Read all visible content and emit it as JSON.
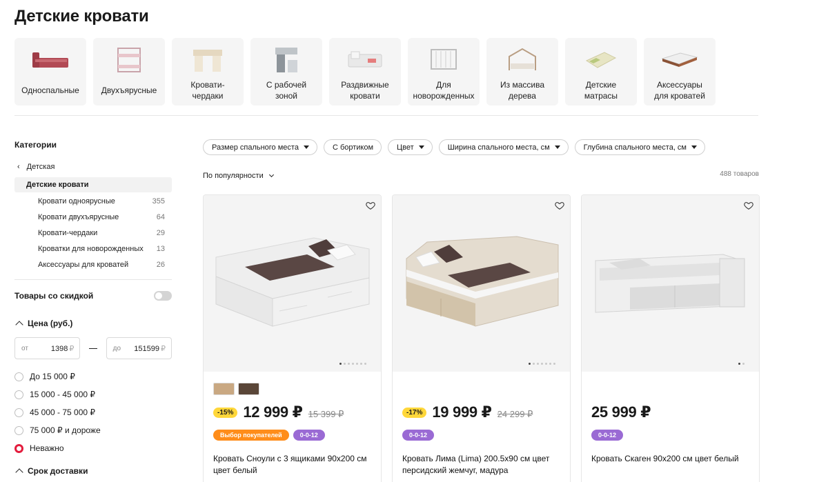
{
  "page": {
    "title": "Детские кровати"
  },
  "categories": [
    {
      "label": "Односпальные",
      "icon": "single-bed-icon"
    },
    {
      "label": "Двухъярусные",
      "icon": "bunk-bed-icon"
    },
    {
      "label": "Кровати-\nчердаки",
      "icon": "loft-bed-icon"
    },
    {
      "label": "С рабочей\nзоной",
      "icon": "workspace-bed-icon"
    },
    {
      "label": "Раздвижные\nкровати",
      "icon": "extendable-bed-icon"
    },
    {
      "label": "Для\nноворожденных",
      "icon": "crib-icon"
    },
    {
      "label": "Из массива\nдерева",
      "icon": "house-bed-icon"
    },
    {
      "label": "Детские\nматрасы",
      "icon": "mattress-icon"
    },
    {
      "label": "Аксессуары\nдля кроватей",
      "icon": "bed-accessory-icon"
    }
  ],
  "sidebar": {
    "heading": "Категории",
    "back_label": "Детская",
    "current": "Детские кровати",
    "subcategories": [
      {
        "label": "Кровати одноярусные",
        "count": "355"
      },
      {
        "label": "Кровати двухъярусные",
        "count": "64"
      },
      {
        "label": "Кровати-чердаки",
        "count": "29"
      },
      {
        "label": "Кроватки для новорожденных",
        "count": "13"
      },
      {
        "label": "Аксессуары для кроватей",
        "count": "26"
      }
    ],
    "discount_label": "Товары со скидкой",
    "discount_on": false,
    "price_heading": "Цена (руб.)",
    "price_from_prefix": "от",
    "price_from": "1398",
    "price_to_prefix": "до",
    "price_to": "151599",
    "currency": "₽",
    "price_options": [
      {
        "label": "До 15 000 ₽",
        "selected": false
      },
      {
        "label": "15 000 - 45 000 ₽",
        "selected": false
      },
      {
        "label": "45 000 - 75 000 ₽",
        "selected": false
      },
      {
        "label": "75 000 ₽ и дороже",
        "selected": false
      },
      {
        "label": "Неважно",
        "selected": true
      }
    ],
    "delivery_heading": "Срок доставки"
  },
  "filters": [
    {
      "label": "Размер спального места",
      "dropdown": true
    },
    {
      "label": "С бортиком",
      "dropdown": false
    },
    {
      "label": "Цвет",
      "dropdown": true
    },
    {
      "label": "Ширина спального места, см",
      "dropdown": true
    },
    {
      "label": "Глубина спального места, см",
      "dropdown": true
    }
  ],
  "sort_label": "По популярности",
  "count_label": "488 товаров",
  "products": [
    {
      "discount": "-15%",
      "price": "12 999 ₽",
      "old_price": "15 399 ₽",
      "tags": [
        {
          "label": "Выбор покупателей",
          "color": "orange"
        },
        {
          "label": "0-0-12",
          "color": "purple"
        }
      ],
      "title": "Кровать Сноули с 3 ящиками 90x200 см цвет белый",
      "swatches": [
        "#c9a882",
        "#5a4638"
      ],
      "dots": 7,
      "active_dot": 0,
      "bed_color": "#eeeeee",
      "accent_color": "#d9d9d9"
    },
    {
      "discount": "-17%",
      "price": "19 999 ₽",
      "old_price": "24 299 ₽",
      "tags": [
        {
          "label": "0-0-12",
          "color": "purple"
        }
      ],
      "title": "Кровать Лима (Lima) 200.5x90 см цвет персидский жемчуг, мадура",
      "swatches": [],
      "dots": 7,
      "active_dot": 0,
      "bed_color": "#e4dccf",
      "accent_color": "#d2c3aa"
    },
    {
      "discount": "",
      "price": "25 999 ₽",
      "old_price": "",
      "tags": [
        {
          "label": "0-0-12",
          "color": "purple"
        }
      ],
      "title": "Кровать Скаген 90x200 см цвет белый",
      "swatches": [],
      "dots": 2,
      "active_dot": 0,
      "bed_color": "#efefef",
      "accent_color": "#dcdcdc"
    }
  ]
}
